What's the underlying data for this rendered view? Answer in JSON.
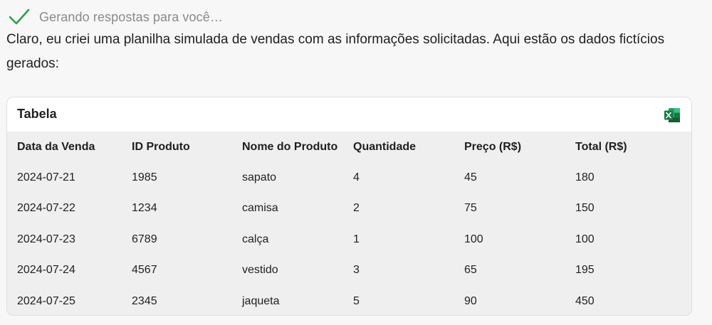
{
  "status": {
    "icon": "check-icon",
    "text": "Gerando respostas para você…",
    "icon_color": "#2e9e4a"
  },
  "message": {
    "text": "Claro, eu criei uma planilha simulada de vendas com as informações solicitadas. Aqui estão os dados fictícios gerados:"
  },
  "table_card": {
    "title": "Tabela",
    "export_icon": "excel-icon",
    "export_color": "#1d7044",
    "columns": [
      "Data da Venda",
      "ID Produto",
      "Nome do Produto",
      "Quantidade",
      "Preço (R$)",
      "Total (R$)"
    ],
    "rows": [
      [
        "2024-07-21",
        "1985",
        "sapato",
        "4",
        "45",
        "180"
      ],
      [
        "2024-07-22",
        "1234",
        "camisa",
        "2",
        "75",
        "150"
      ],
      [
        "2024-07-23",
        "6789",
        "calça",
        "1",
        "100",
        "100"
      ],
      [
        "2024-07-24",
        "4567",
        "vestido",
        "3",
        "65",
        "195"
      ],
      [
        "2024-07-25",
        "2345",
        "jaqueta",
        "5",
        "90",
        "450"
      ]
    ]
  }
}
